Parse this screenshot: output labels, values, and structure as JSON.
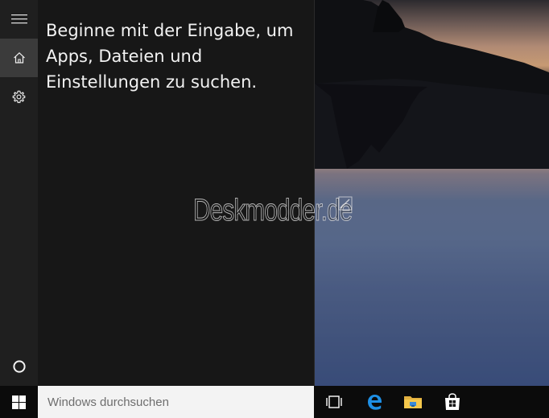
{
  "cortana": {
    "hint_text": "Beginne mit der Eingabe, um Apps, Dateien und Einstellungen zu suchen."
  },
  "watermark": {
    "text": "Deskmodder.de"
  },
  "sidebar": {
    "items": [
      {
        "name": "hamburger-menu",
        "icon": "hamburger-icon",
        "active": false
      },
      {
        "name": "home",
        "icon": "home-icon",
        "active": true
      },
      {
        "name": "settings",
        "icon": "gear-icon",
        "active": false
      }
    ],
    "cortana_icon": "cortana-circle-icon"
  },
  "taskbar": {
    "search_placeholder": "Windows durchsuchen",
    "search_value": "",
    "start_icon": "windows-logo-icon",
    "apps": [
      {
        "name": "task-view",
        "icon": "task-view-icon"
      },
      {
        "name": "edge",
        "icon": "edge-icon"
      },
      {
        "name": "file-explorer",
        "icon": "folder-icon"
      },
      {
        "name": "store",
        "icon": "store-icon"
      }
    ]
  },
  "colors": {
    "accent": "#0078d7",
    "panel_bg": "#171717",
    "rail_bg": "#1f1f1f",
    "rail_active": "#3b3b3b",
    "taskbar_bg": "#0b0b0b"
  }
}
